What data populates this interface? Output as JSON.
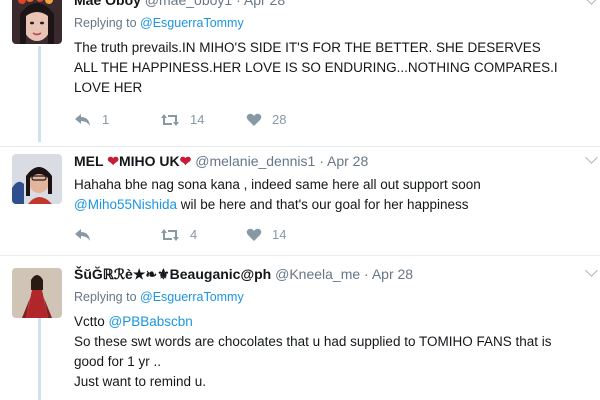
{
  "tweets": [
    {
      "name": "Mae Oboy",
      "handle": "@mae_oboy1",
      "date": "Apr 28",
      "replying_prefix": "Replying to",
      "replying_to": "@EsguerraTommy",
      "text_lines": [
        "The truth prevails.IN MIHO'S SIDE IT'S  FOR THE BETTER. SHE DESERVES",
        "ALL THE HAPPINESS.HER LOVE IS SO ENDURING...NOTHING COMPARES.I",
        "LOVE HER"
      ],
      "replies": "1",
      "retweets": "14",
      "likes": "28"
    },
    {
      "name_part1": "MEL",
      "name_part2": "MIHO UK",
      "handle": "@melanie_dennis1",
      "date": "Apr 28",
      "text_line1": "Hahaha bhe nag sona kana , indeed same here all out support soon",
      "mention": "@Miho55Nishida",
      "text_line2": " wil be here and that's our goal for her happiness",
      "retweets": "4",
      "likes": "14"
    },
    {
      "name": "ŠŭĞℝℛè★❧⚜Beauganic@ph",
      "handle": "@Kneela_me",
      "date": "Apr 28",
      "replying_prefix": "Replying to",
      "replying_to": "@EsguerraTommy",
      "line1_prefix": "Vctto ",
      "line1_mention": "@PBBabscbn",
      "text_lines": [
        "So these swt words are chocolates  that u had supplied to TOMIHO FANS that is",
        "good for 1 yr ..",
        "Just want to remind u."
      ]
    }
  ],
  "icons": [
    "reply-icon",
    "retweet-icon",
    "like-icon",
    "heart-emoji-icon",
    "fleur-de-lis-icon"
  ],
  "colors": {
    "link": "#1b95e0",
    "muted": "#657786",
    "heart": "#c81b34",
    "thread": "#cfe1ec"
  }
}
